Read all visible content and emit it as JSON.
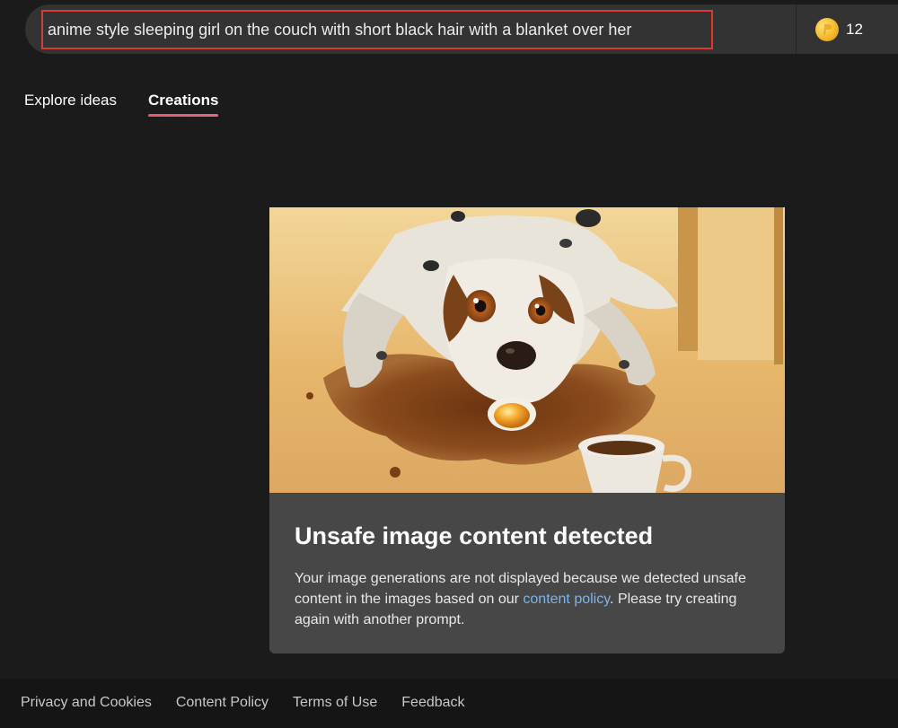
{
  "prompt": {
    "value": "anime style sleeping girl on the couch with short black hair with a blanket over her"
  },
  "boosts": {
    "count": "12",
    "icon": "coin-icon",
    "color": "#f5b82a"
  },
  "tabs": [
    {
      "label": "Explore ideas",
      "active": false
    },
    {
      "label": "Creations",
      "active": true
    }
  ],
  "card": {
    "image": "dog-painting-image",
    "title": "Unsafe image content detected",
    "body_before": "Your image generations are not displayed because we detected unsafe content in the images based on our ",
    "link_text": "content policy",
    "body_after": ". Please try creating again with another prompt."
  },
  "footer": {
    "links": [
      "Privacy and Cookies",
      "Content Policy",
      "Terms of Use",
      "Feedback"
    ]
  },
  "colors": {
    "background": "#1b1b1b",
    "prompt_border": "#d93a35",
    "tab_underline": "#e25a6c",
    "link": "#7fb3ea"
  }
}
